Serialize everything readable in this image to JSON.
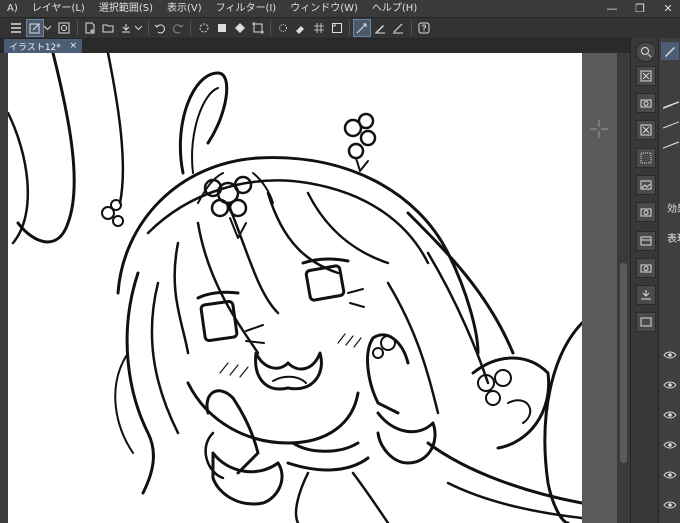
{
  "menubar": {
    "items": [
      {
        "label": "A)"
      },
      {
        "label": "レイヤー(L)"
      },
      {
        "label": "選択範囲(S)"
      },
      {
        "label": "表示(V)"
      },
      {
        "label": "フィルター(I)"
      },
      {
        "label": "ウィンドウ(W)"
      },
      {
        "label": "ヘルプ(H)"
      }
    ],
    "window_controls": {
      "minimize": "—",
      "maximize": "❐",
      "close": "✕"
    }
  },
  "toolbar": {
    "icons": [
      "menu-icon",
      "new-canvas-icon",
      "chevron-down-icon",
      "swirl-icon",
      "new-file-icon",
      "open-folder-icon",
      "save-icon",
      "print-icon",
      "undo-icon",
      "redo-icon",
      "loading-icon",
      "fill-icon",
      "transform-icon",
      "crop-icon",
      "snap-ruler-icon",
      "brush-snap-icon",
      "straight-line-icon",
      "help-icon"
    ]
  },
  "document_tab": {
    "title": "イラスト12*",
    "close": "×"
  },
  "right_panel": {
    "effect_label": "効果",
    "expression_label": "表現"
  },
  "colors": {
    "accent": "#4a5d75",
    "panel": "#383838",
    "canvas": "#ffffff",
    "workspace": "#5a5a5a"
  }
}
